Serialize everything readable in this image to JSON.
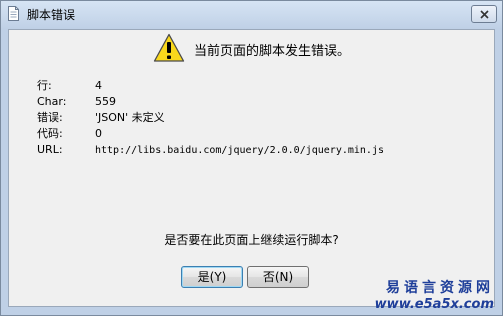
{
  "window": {
    "title": "脚本错误",
    "close_icon": "close-icon"
  },
  "dialog": {
    "icon": "warning-icon",
    "message": "当前页面的脚本发生错误。",
    "details": [
      {
        "label": "行:",
        "value": "4"
      },
      {
        "label": "Char:",
        "value": "559"
      },
      {
        "label": "错误:",
        "value": "'JSON' 未定义"
      },
      {
        "label": "代码:",
        "value": "0"
      },
      {
        "label": "URL:",
        "value": "http://libs.baidu.com/jquery/2.0.0/jquery.min.js"
      }
    ],
    "question": "是否要在此页面上继续运行脚本?",
    "buttons": {
      "yes": "是(Y)",
      "no": "否(N)"
    }
  },
  "watermark": {
    "title": "易语言资源网",
    "url": "www.e5a5x.com"
  },
  "colors": {
    "window_frame": "#bfd0e6",
    "client_bg": "#f0f0f0",
    "watermark": "#1f3f9a"
  }
}
